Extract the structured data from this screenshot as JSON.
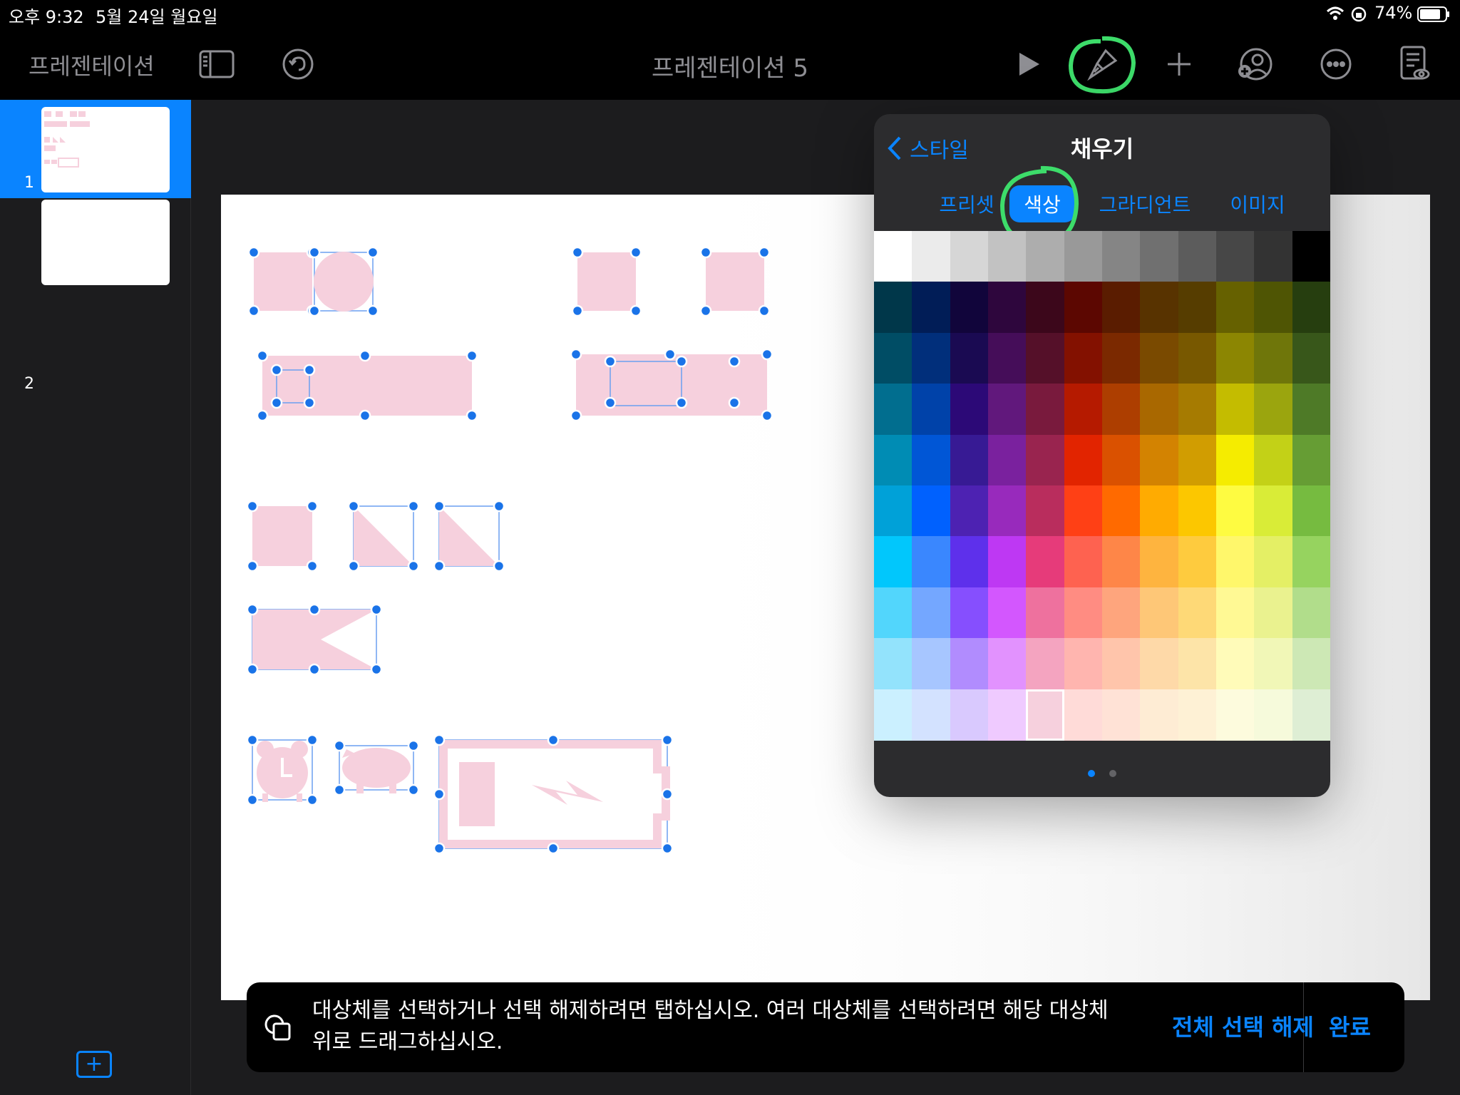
{
  "status_bar": {
    "time": "오후 9:32",
    "date": "5월 24일 월요일",
    "battery": "74%"
  },
  "toolbar": {
    "back_label": "프레젠테이션",
    "document_title": "프레젠테이션 5"
  },
  "sidebar": {
    "slides": [
      {
        "number": "1"
      },
      {
        "number": "2"
      }
    ]
  },
  "popover": {
    "back_label": "스타일",
    "title": "채우기",
    "tabs": [
      "프리셋",
      "색상",
      "그라디언트",
      "이미지"
    ],
    "active_tab": "색상",
    "selected_color": "#f6d0dd",
    "color_rows": [
      [
        "#ffffff",
        "#ebebeb",
        "#d6d6d6",
        "#c2c2c2",
        "#adadad",
        "#999999",
        "#858585",
        "#707070",
        "#5c5c5c",
        "#474747",
        "#333333",
        "#000000"
      ],
      [
        "#00374a",
        "#011d57",
        "#11053b",
        "#2e063d",
        "#3c071b",
        "#5c0701",
        "#5a1c00",
        "#583300",
        "#563d00",
        "#666100",
        "#4f5504",
        "#263e0f"
      ],
      [
        "#004d65",
        "#012f7b",
        "#1a0a52",
        "#450d59",
        "#551029",
        "#831100",
        "#7b2900",
        "#7a4a00",
        "#785800",
        "#8c8602",
        "#6f760a",
        "#38571a"
      ],
      [
        "#016e8f",
        "#0042a9",
        "#2c0977",
        "#61187c",
        "#791a3d",
        "#b51a00",
        "#ad3e00",
        "#a96800",
        "#a67b01",
        "#c4bc00",
        "#9ba50e",
        "#4e7a27"
      ],
      [
        "#008cb4",
        "#0056d6",
        "#371a94",
        "#7a219e",
        "#99244f",
        "#e22400",
        "#da5100",
        "#d38301",
        "#d19d01",
        "#f5ec00",
        "#c3d117",
        "#669d34"
      ],
      [
        "#00a1d8",
        "#0061fe",
        "#4d22b2",
        "#982abc",
        "#b92d5d",
        "#ff4015",
        "#ff6a00",
        "#ffab01",
        "#fcc700",
        "#fefb41",
        "#d9ec37",
        "#76bb40"
      ],
      [
        "#01c7fc",
        "#3a87fe",
        "#5e30eb",
        "#be38f3",
        "#e63b7a",
        "#fe6250",
        "#fe8648",
        "#feb43f",
        "#fecb3e",
        "#fff76b",
        "#e4ef65",
        "#96d35f"
      ],
      [
        "#52d6fc",
        "#74a7ff",
        "#864ffe",
        "#d357fe",
        "#ee719e",
        "#ff8c82",
        "#fea57d",
        "#fec777",
        "#fed977",
        "#fff994",
        "#eaf28f",
        "#b1dd8b"
      ],
      [
        "#93e3fc",
        "#a7c6ff",
        "#b18cfe",
        "#e292fe",
        "#f4a4c0",
        "#ffb5af",
        "#ffc5ab",
        "#fed9a8",
        "#fde4a8",
        "#fffbb9",
        "#f1f7b7",
        "#cde8b5"
      ],
      [
        "#cbf0ff",
        "#d3e2ff",
        "#d9c9fe",
        "#efcaff",
        "#f6d0dd",
        "#ffdbd8",
        "#ffe2d6",
        "#feecd4",
        "#fef1d5",
        "#fdfbdd",
        "#f6fadb",
        "#deeed4"
      ]
    ],
    "page_dots": 2
  },
  "hint_bar": {
    "text": "대상체를 선택하거나 선택 해제하려면 탭하십시오. 여러 대상체를 선택하려면 해당 대상체 위로 드래그하십시오.",
    "deselect_all": "전체 선택 해제",
    "done": "완료"
  },
  "colors": {
    "accent": "#0a84ff",
    "shape_fill": "#f6d0dd",
    "handle": "#1a73e8",
    "annotation": "#3ddc6a"
  }
}
